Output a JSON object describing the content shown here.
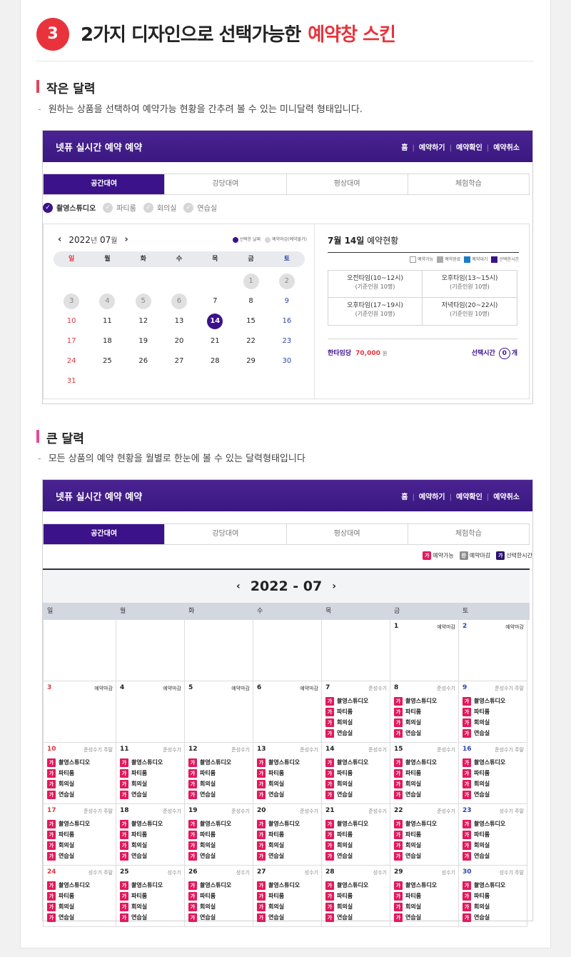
{
  "section": {
    "number": "3",
    "title": "2가지 디자인으로 선택가능한",
    "highlight": "예약창 스킨"
  },
  "small": {
    "title": "작은 달력",
    "desc": "원하는 상품을 선택하여 예약가능 현황을 간추려 볼 수 있는 미니달력 형태입니다."
  },
  "large": {
    "title": "큰 달력",
    "desc": "모든 상품의 예약 현황을 월별로 한눈에 볼 수 있는 달력형태입니다"
  },
  "frame": {
    "title": "넷퓨 실시간 예약 예약",
    "nav": [
      "홈",
      "예약하기",
      "예약확인",
      "예약취소"
    ],
    "tabs": [
      "공간대여",
      "강당대여",
      "평상대여",
      "체험학습"
    ]
  },
  "rooms": [
    "촬영스튜디오",
    "파티룸",
    "회의실",
    "연습실"
  ],
  "mini": {
    "year": "2022",
    "year_suffix": "년",
    "month": "07",
    "month_suffix": "월",
    "legend": [
      "선택한 날짜",
      "예약마감(예약불가)"
    ],
    "weekdays": [
      "일",
      "월",
      "화",
      "수",
      "목",
      "금",
      "토"
    ],
    "days": [
      {
        "d": "",
        "t": ""
      },
      {
        "d": "",
        "t": ""
      },
      {
        "d": "",
        "t": ""
      },
      {
        "d": "",
        "t": ""
      },
      {
        "d": "",
        "t": ""
      },
      {
        "d": "1",
        "t": "past"
      },
      {
        "d": "2",
        "t": "past"
      },
      {
        "d": "3",
        "t": "past"
      },
      {
        "d": "4",
        "t": "past"
      },
      {
        "d": "5",
        "t": "past"
      },
      {
        "d": "6",
        "t": "past"
      },
      {
        "d": "7",
        "t": ""
      },
      {
        "d": "8",
        "t": ""
      },
      {
        "d": "9",
        "t": "sat"
      },
      {
        "d": "10",
        "t": "sun"
      },
      {
        "d": "11",
        "t": ""
      },
      {
        "d": "12",
        "t": ""
      },
      {
        "d": "13",
        "t": ""
      },
      {
        "d": "14",
        "t": "sel"
      },
      {
        "d": "15",
        "t": ""
      },
      {
        "d": "16",
        "t": "sat"
      },
      {
        "d": "17",
        "t": "sun"
      },
      {
        "d": "18",
        "t": ""
      },
      {
        "d": "19",
        "t": ""
      },
      {
        "d": "20",
        "t": ""
      },
      {
        "d": "21",
        "t": ""
      },
      {
        "d": "22",
        "t": ""
      },
      {
        "d": "23",
        "t": "sat"
      },
      {
        "d": "24",
        "t": "sun"
      },
      {
        "d": "25",
        "t": ""
      },
      {
        "d": "26",
        "t": ""
      },
      {
        "d": "27",
        "t": ""
      },
      {
        "d": "28",
        "t": ""
      },
      {
        "d": "29",
        "t": ""
      },
      {
        "d": "30",
        "t": "sat"
      },
      {
        "d": "31",
        "t": "sun"
      }
    ],
    "status_date": "7월 14일",
    "status_label": "예약현황",
    "status_legend": [
      {
        "label": "예약가능",
        "color": "#ffffff"
      },
      {
        "label": "예약완료",
        "color": "#a9a9a9"
      },
      {
        "label": "예약대기",
        "color": "#1c7cc7"
      },
      {
        "label": "선택한시간",
        "color": "#3c128a"
      }
    ],
    "slots": [
      {
        "time": "오전타임(10~12시)",
        "cap": "(기준인원 10명)"
      },
      {
        "time": "오후타임(13~15시)",
        "cap": "(기준인원 10명)"
      },
      {
        "time": "오후타임(17~19시)",
        "cap": "(기준인원 10명)"
      },
      {
        "time": "저녁타임(20~22시)",
        "cap": "(기준인원 10명)"
      }
    ],
    "price_label": "한타임당",
    "price": "70,000",
    "price_unit": "원",
    "selected_label": "선택시간",
    "selected_count": "0",
    "selected_unit": "개"
  },
  "big": {
    "legend": [
      {
        "glyph": "가",
        "label": "예약가능",
        "color": "#e2195b"
      },
      {
        "glyph": "완",
        "label": "예약마감",
        "color": "#8c8c8c"
      },
      {
        "glyph": "가",
        "label": "선택한시간",
        "color": "#2a1070"
      }
    ],
    "month_title": "2022 - 07",
    "weekdays": [
      "일",
      "월",
      "화",
      "수",
      "목",
      "금",
      "토"
    ],
    "glyph": "가",
    "cells": [
      {
        "d": "",
        "s": "",
        "items": false,
        "c": ""
      },
      {
        "d": "",
        "s": "",
        "items": false,
        "c": ""
      },
      {
        "d": "",
        "s": "",
        "items": false,
        "c": ""
      },
      {
        "d": "",
        "s": "",
        "items": false,
        "c": ""
      },
      {
        "d": "",
        "s": "",
        "items": false,
        "c": ""
      },
      {
        "d": "1",
        "s": "예약마감",
        "items": false,
        "c": "closed"
      },
      {
        "d": "2",
        "s": "예약마감",
        "items": false,
        "c": "sat closed"
      },
      {
        "d": "3",
        "s": "예약마감",
        "items": false,
        "c": "sun closed"
      },
      {
        "d": "4",
        "s": "예약마감",
        "items": false,
        "c": "closed"
      },
      {
        "d": "5",
        "s": "예약마감",
        "items": false,
        "c": "closed"
      },
      {
        "d": "6",
        "s": "예약마감",
        "items": false,
        "c": "closed"
      },
      {
        "d": "7",
        "s": "준성수기",
        "items": true,
        "c": ""
      },
      {
        "d": "8",
        "s": "준성수기",
        "items": true,
        "c": ""
      },
      {
        "d": "9",
        "s": "준성수기 주말",
        "items": true,
        "c": "sat"
      },
      {
        "d": "10",
        "s": "준성수기 주말",
        "items": true,
        "c": "sun"
      },
      {
        "d": "11",
        "s": "준성수기",
        "items": true,
        "c": ""
      },
      {
        "d": "12",
        "s": "준성수기",
        "items": true,
        "c": ""
      },
      {
        "d": "13",
        "s": "준성수기",
        "items": true,
        "c": ""
      },
      {
        "d": "14",
        "s": "준성수기",
        "items": true,
        "c": ""
      },
      {
        "d": "15",
        "s": "준성수기",
        "items": true,
        "c": ""
      },
      {
        "d": "16",
        "s": "준성수기 주말",
        "items": true,
        "c": "sat"
      },
      {
        "d": "17",
        "s": "준성수기 주말",
        "items": true,
        "c": "sun"
      },
      {
        "d": "18",
        "s": "준성수기",
        "items": true,
        "c": ""
      },
      {
        "d": "19",
        "s": "준성수기",
        "items": true,
        "c": ""
      },
      {
        "d": "20",
        "s": "준성수기",
        "items": true,
        "c": ""
      },
      {
        "d": "21",
        "s": "준성수기",
        "items": true,
        "c": ""
      },
      {
        "d": "22",
        "s": "준성수기",
        "items": true,
        "c": ""
      },
      {
        "d": "23",
        "s": "성수기 주말",
        "items": true,
        "c": "sat"
      },
      {
        "d": "24",
        "s": "성수기 주말",
        "items": true,
        "c": "sun"
      },
      {
        "d": "25",
        "s": "성수기",
        "items": true,
        "c": ""
      },
      {
        "d": "26",
        "s": "성수기",
        "items": true,
        "c": ""
      },
      {
        "d": "27",
        "s": "성수기",
        "items": true,
        "c": ""
      },
      {
        "d": "28",
        "s": "성수기",
        "items": true,
        "c": ""
      },
      {
        "d": "29",
        "s": "성수기",
        "items": true,
        "c": ""
      },
      {
        "d": "30",
        "s": "성수기 주말",
        "items": true,
        "c": "sat"
      }
    ]
  }
}
